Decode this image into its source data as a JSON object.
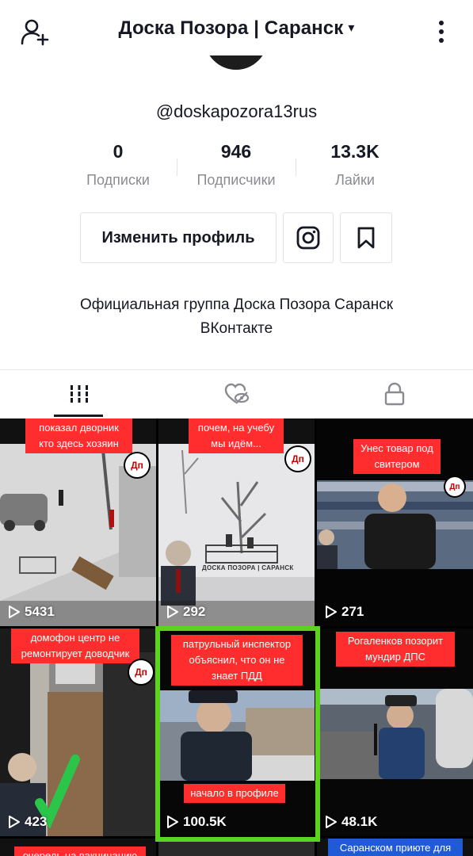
{
  "header": {
    "title": "Доска Позора | Саранск",
    "caret": "▾"
  },
  "profile": {
    "handle": "@doskapozora13rus",
    "stats": [
      {
        "value": "0",
        "label": "Подписки"
      },
      {
        "value": "946",
        "label": "Подписчики"
      },
      {
        "value": "13.3K",
        "label": "Лайки"
      }
    ],
    "edit_button": "Изменить профиль",
    "bio_line1": "Официальная группа Доска Позора Саранск",
    "bio_line2": "ВКонтакте"
  },
  "tabs": [
    {
      "icon": "grid-icon",
      "active": true
    },
    {
      "icon": "liked-hidden-icon",
      "active": false
    },
    {
      "icon": "lock-icon",
      "active": false
    }
  ],
  "videos": [
    {
      "caption": "показал дворник кто здесь хозяин",
      "views": "5431"
    },
    {
      "caption": "почем, на учебу мы идём...",
      "views": "292"
    },
    {
      "caption": "Унес товар под свитером",
      "views": "271"
    },
    {
      "caption": "домофон центр не ремонтирует доводчик",
      "views": "423"
    },
    {
      "caption": "патрульный инспектор объяснил, что он не знает ПДД",
      "caption2": "начало в профиле",
      "views": "100.5K"
    },
    {
      "caption": "Рогаленков позорит мундир ДПС",
      "views": "48.1K"
    },
    {
      "caption": "очередь на вакцинацию"
    },
    {
      "caption": "Саранском приюте для"
    }
  ],
  "watermark": {
    "tile2": "ДОСКА ПОЗОРА | САРАНСК"
  },
  "badge_text": "Дп",
  "colors": {
    "caption_red": "#ff2d2d",
    "highlight_green": "#5dd320",
    "caption_blue": "#1f5bd6"
  }
}
